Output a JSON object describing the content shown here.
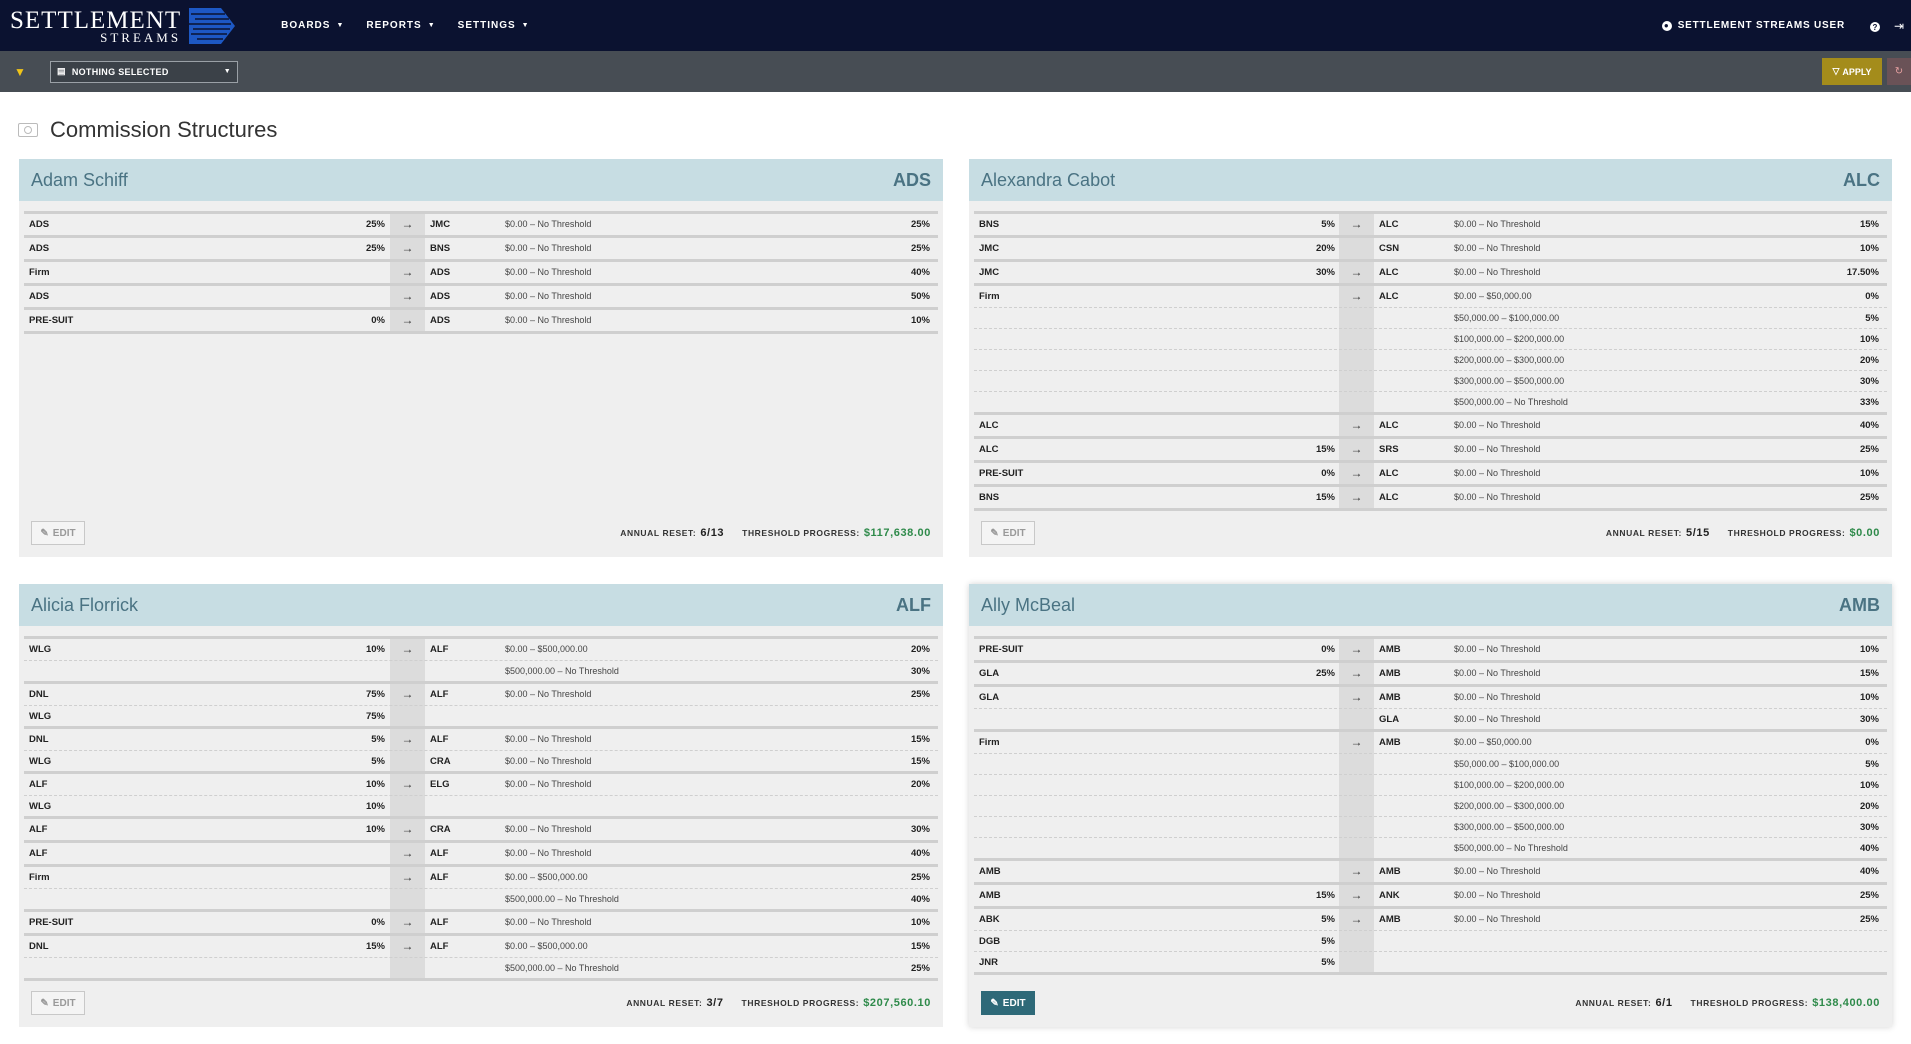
{
  "app": {
    "logo_main": "SETTLEMENT",
    "logo_sub": "STREAMS",
    "nav": [
      "BOARDS",
      "REPORTS",
      "SETTINGS"
    ],
    "user": "SETTLEMENT STREAMS USER"
  },
  "filterbar": {
    "select_value": "NOTHING SELECTED",
    "apply_label": "APPLY"
  },
  "page": {
    "title": "Commission Structures"
  },
  "labels": {
    "edit": "EDIT",
    "annual_reset": "ANNUAL RESET:",
    "threshold_progress": "THRESHOLD PROGRESS:",
    "arrow": "→"
  },
  "cards": [
    {
      "name": "Adam Schiff",
      "code": "ADS",
      "annual_reset": "6/13",
      "threshold_progress": "$117,638.00",
      "edit_active": false,
      "rows": [
        {
          "sources": [
            {
              "code": "ADS",
              "pct": "25%"
            }
          ],
          "targets": [
            {
              "code": "JMC",
              "tiers": [
                {
                  "range": "$0.00 – No Threshold",
                  "pct": "25%"
                }
              ]
            }
          ]
        },
        {
          "sources": [
            {
              "code": "ADS",
              "pct": "25%"
            }
          ],
          "targets": [
            {
              "code": "BNS",
              "tiers": [
                {
                  "range": "$0.00 – No Threshold",
                  "pct": "25%"
                }
              ]
            }
          ]
        },
        {
          "sources": [
            {
              "code": "Firm",
              "pct": ""
            }
          ],
          "targets": [
            {
              "code": "ADS",
              "tiers": [
                {
                  "range": "$0.00 – No Threshold",
                  "pct": "40%"
                }
              ]
            }
          ]
        },
        {
          "sources": [
            {
              "code": "ADS",
              "pct": ""
            }
          ],
          "targets": [
            {
              "code": "ADS",
              "tiers": [
                {
                  "range": "$0.00 – No Threshold",
                  "pct": "50%"
                }
              ]
            }
          ]
        },
        {
          "sources": [
            {
              "code": "PRE-SUIT",
              "pct": "0%"
            }
          ],
          "targets": [
            {
              "code": "ADS",
              "tiers": [
                {
                  "range": "$0.00 – No Threshold",
                  "pct": "10%"
                }
              ]
            }
          ]
        }
      ]
    },
    {
      "name": "Alexandra Cabot",
      "code": "ALC",
      "annual_reset": "5/15",
      "threshold_progress": "$0.00",
      "edit_active": false,
      "rows": [
        {
          "sources": [
            {
              "code": "BNS",
              "pct": "5%"
            }
          ],
          "targets": [
            {
              "code": "ALC",
              "tiers": [
                {
                  "range": "$0.00 – No Threshold",
                  "pct": "15%"
                }
              ]
            }
          ]
        },
        {
          "sources": [
            {
              "code": "JMC",
              "pct": "20%"
            }
          ],
          "targets": [
            {
              "code": "CSN",
              "tiers": [
                {
                  "range": "$0.00 – No Threshold",
                  "pct": "10%"
                }
              ]
            }
          ],
          "no_arrow": true
        },
        {
          "sources": [
            {
              "code": "JMC",
              "pct": "30%"
            }
          ],
          "targets": [
            {
              "code": "ALC",
              "tiers": [
                {
                  "range": "$0.00 – No Threshold",
                  "pct": "17.50%"
                }
              ]
            }
          ]
        },
        {
          "sources": [
            {
              "code": "Firm",
              "pct": ""
            }
          ],
          "targets": [
            {
              "code": "ALC",
              "tiers": [
                {
                  "range": "$0.00 – $50,000.00",
                  "pct": "0%"
                },
                {
                  "range": "$50,000.00 – $100,000.00",
                  "pct": "5%"
                },
                {
                  "range": "$100,000.00 – $200,000.00",
                  "pct": "10%"
                },
                {
                  "range": "$200,000.00 – $300,000.00",
                  "pct": "20%"
                },
                {
                  "range": "$300,000.00 – $500,000.00",
                  "pct": "30%"
                },
                {
                  "range": "$500,000.00 – No Threshold",
                  "pct": "33%"
                }
              ]
            }
          ]
        },
        {
          "sources": [
            {
              "code": "ALC",
              "pct": ""
            }
          ],
          "targets": [
            {
              "code": "ALC",
              "tiers": [
                {
                  "range": "$0.00 – No Threshold",
                  "pct": "40%"
                }
              ]
            }
          ]
        },
        {
          "sources": [
            {
              "code": "ALC",
              "pct": "15%"
            }
          ],
          "targets": [
            {
              "code": "SRS",
              "tiers": [
                {
                  "range": "$0.00 – No Threshold",
                  "pct": "25%"
                }
              ]
            }
          ]
        },
        {
          "sources": [
            {
              "code": "PRE-SUIT",
              "pct": "0%"
            }
          ],
          "targets": [
            {
              "code": "ALC",
              "tiers": [
                {
                  "range": "$0.00 – No Threshold",
                  "pct": "10%"
                }
              ]
            }
          ]
        },
        {
          "sources": [
            {
              "code": "BNS",
              "pct": "15%"
            }
          ],
          "targets": [
            {
              "code": "ALC",
              "tiers": [
                {
                  "range": "$0.00 – No Threshold",
                  "pct": "25%"
                }
              ]
            }
          ]
        }
      ]
    },
    {
      "name": "Alicia Florrick",
      "code": "ALF",
      "annual_reset": "3/7",
      "threshold_progress": "$207,560.10",
      "edit_active": false,
      "rows": [
        {
          "sources": [
            {
              "code": "WLG",
              "pct": "10%"
            }
          ],
          "targets": [
            {
              "code": "ALF",
              "tiers": [
                {
                  "range": "$0.00 – $500,000.00",
                  "pct": "20%"
                },
                {
                  "range": "$500,000.00 – No Threshold",
                  "pct": "30%"
                }
              ]
            }
          ]
        },
        {
          "sources": [
            {
              "code": "DNL",
              "pct": "75%"
            },
            {
              "code": "WLG",
              "pct": "75%"
            }
          ],
          "targets": [
            {
              "code": "ALF",
              "tiers": [
                {
                  "range": "$0.00 – No Threshold",
                  "pct": "25%"
                }
              ]
            }
          ]
        },
        {
          "sources": [
            {
              "code": "DNL",
              "pct": "5%"
            },
            {
              "code": "WLG",
              "pct": "5%"
            }
          ],
          "targets": [
            {
              "code": "ALF",
              "tiers": [
                {
                  "range": "$0.00 – No Threshold",
                  "pct": "15%"
                }
              ]
            },
            {
              "code": "CRA",
              "tiers": [
                {
                  "range": "$0.00 – No Threshold",
                  "pct": "15%"
                }
              ]
            }
          ]
        },
        {
          "sources": [
            {
              "code": "ALF",
              "pct": "10%"
            },
            {
              "code": "WLG",
              "pct": "10%"
            }
          ],
          "targets": [
            {
              "code": "ELG",
              "tiers": [
                {
                  "range": "$0.00 – No Threshold",
                  "pct": "20%"
                }
              ]
            }
          ]
        },
        {
          "sources": [
            {
              "code": "ALF",
              "pct": "10%"
            }
          ],
          "targets": [
            {
              "code": "CRA",
              "tiers": [
                {
                  "range": "$0.00 – No Threshold",
                  "pct": "30%"
                }
              ]
            }
          ]
        },
        {
          "sources": [
            {
              "code": "ALF",
              "pct": ""
            }
          ],
          "targets": [
            {
              "code": "ALF",
              "tiers": [
                {
                  "range": "$0.00 – No Threshold",
                  "pct": "40%"
                }
              ]
            }
          ]
        },
        {
          "sources": [
            {
              "code": "Firm",
              "pct": ""
            }
          ],
          "targets": [
            {
              "code": "ALF",
              "tiers": [
                {
                  "range": "$0.00 – $500,000.00",
                  "pct": "25%"
                },
                {
                  "range": "$500,000.00 – No Threshold",
                  "pct": "40%"
                }
              ]
            }
          ]
        },
        {
          "sources": [
            {
              "code": "PRE-SUIT",
              "pct": "0%"
            }
          ],
          "targets": [
            {
              "code": "ALF",
              "tiers": [
                {
                  "range": "$0.00 – No Threshold",
                  "pct": "10%"
                }
              ]
            }
          ]
        },
        {
          "sources": [
            {
              "code": "DNL",
              "pct": "15%"
            }
          ],
          "targets": [
            {
              "code": "ALF",
              "tiers": [
                {
                  "range": "$0.00 – $500,000.00",
                  "pct": "15%"
                },
                {
                  "range": "$500,000.00 – No Threshold",
                  "pct": "25%"
                }
              ]
            }
          ]
        }
      ]
    },
    {
      "name": "Ally McBeal",
      "code": "AMB",
      "annual_reset": "6/1",
      "threshold_progress": "$138,400.00",
      "edit_active": true,
      "rows": [
        {
          "sources": [
            {
              "code": "PRE-SUIT",
              "pct": "0%"
            }
          ],
          "targets": [
            {
              "code": "AMB",
              "tiers": [
                {
                  "range": "$0.00 – No Threshold",
                  "pct": "10%"
                }
              ]
            }
          ]
        },
        {
          "sources": [
            {
              "code": "GLA",
              "pct": "25%"
            }
          ],
          "targets": [
            {
              "code": "AMB",
              "tiers": [
                {
                  "range": "$0.00 – No Threshold",
                  "pct": "15%"
                }
              ]
            }
          ]
        },
        {
          "sources": [
            {
              "code": "GLA",
              "pct": ""
            }
          ],
          "targets": [
            {
              "code": "AMB",
              "tiers": [
                {
                  "range": "$0.00 – No Threshold",
                  "pct": "10%"
                }
              ]
            },
            {
              "code": "GLA",
              "tiers": [
                {
                  "range": "$0.00 – No Threshold",
                  "pct": "30%"
                }
              ]
            }
          ]
        },
        {
          "sources": [
            {
              "code": "Firm",
              "pct": ""
            }
          ],
          "targets": [
            {
              "code": "AMB",
              "tiers": [
                {
                  "range": "$0.00 – $50,000.00",
                  "pct": "0%"
                },
                {
                  "range": "$50,000.00 – $100,000.00",
                  "pct": "5%"
                },
                {
                  "range": "$100,000.00 – $200,000.00",
                  "pct": "10%"
                },
                {
                  "range": "$200,000.00 – $300,000.00",
                  "pct": "20%"
                },
                {
                  "range": "$300,000.00 – $500,000.00",
                  "pct": "30%"
                },
                {
                  "range": "$500,000.00 – No Threshold",
                  "pct": "40%"
                }
              ]
            }
          ]
        },
        {
          "sources": [
            {
              "code": "AMB",
              "pct": ""
            }
          ],
          "targets": [
            {
              "code": "AMB",
              "tiers": [
                {
                  "range": "$0.00 – No Threshold",
                  "pct": "40%"
                }
              ]
            }
          ]
        },
        {
          "sources": [
            {
              "code": "AMB",
              "pct": "15%"
            }
          ],
          "targets": [
            {
              "code": "ANK",
              "tiers": [
                {
                  "range": "$0.00 – No Threshold",
                  "pct": "25%"
                }
              ]
            }
          ]
        },
        {
          "sources": [
            {
              "code": "ABK",
              "pct": "5%"
            },
            {
              "code": "DGB",
              "pct": "5%"
            },
            {
              "code": "JNR",
              "pct": "5%"
            }
          ],
          "targets": [
            {
              "code": "AMB",
              "tiers": [
                {
                  "range": "$0.00 – No Threshold",
                  "pct": "25%"
                }
              ]
            }
          ]
        }
      ]
    }
  ]
}
